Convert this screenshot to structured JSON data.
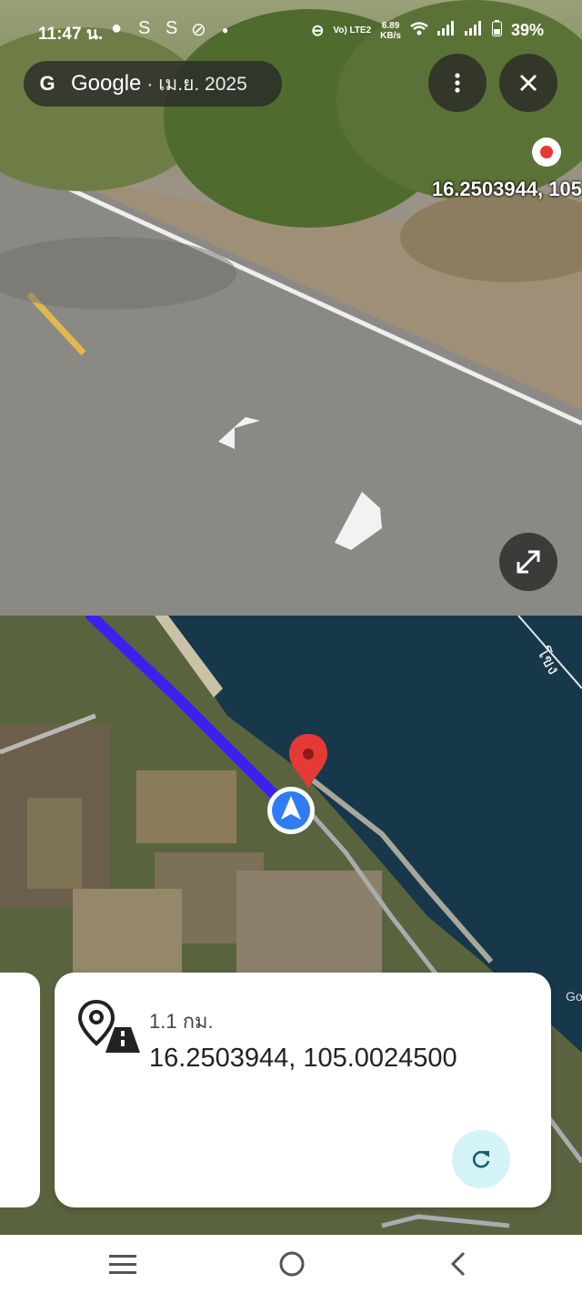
{
  "status_bar": {
    "time": "11:47 น.",
    "notif_icons": [
      "message-icon",
      "s-icon",
      "s-icon",
      "no-disturb-icon",
      "dot"
    ],
    "network_label": "Vo) LTE2",
    "speed_value": "6.89",
    "speed_unit": "KB/s",
    "battery": "39%"
  },
  "street_view": {
    "brand": "Google",
    "date": "· เม.ย. 2025",
    "coordinate_overlay": "16.2503944, 105"
  },
  "map": {
    "river_label": "โขง",
    "partial_label": "Goo"
  },
  "info_card": {
    "distance": "1.1 กม.",
    "coordinates": "16.2503944, 105.0024500"
  },
  "colors": {
    "route": "#3d1ff0",
    "marker": "#e53935",
    "location_dot": "#2f7cf6",
    "refresh_bg": "#d3f3f6"
  }
}
